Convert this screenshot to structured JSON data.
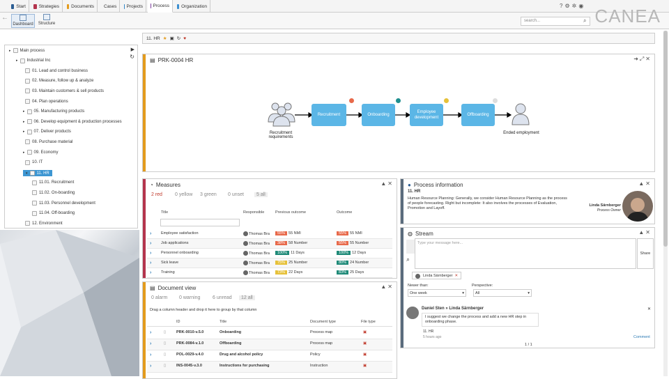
{
  "tabs": [
    "Start",
    "Strategies",
    "Documents",
    "Cases",
    "Projects",
    "Process",
    "Organization"
  ],
  "tab_colors": [
    "#2c5d93",
    "#b4344d",
    "#e39b1d",
    "#4aa34a",
    "#2f86c6",
    "#7d3c9e",
    "#3c8fd0"
  ],
  "subtabs": [
    "Dashboard",
    "Structure"
  ],
  "logo": "CANEA",
  "search_placeholder": "search...",
  "toolbar_label": "11. HR",
  "tree": [
    {
      "label": "Main process",
      "lvl": 0
    },
    {
      "label": "Industrial Inc",
      "lvl": 1
    },
    {
      "label": "01. Lead and control business",
      "lvl": 2
    },
    {
      "label": "02. Measure, follow up & analyze",
      "lvl": 2
    },
    {
      "label": "03. Maintain customers & sell products",
      "lvl": 2
    },
    {
      "label": "04. Plan operations",
      "lvl": 2
    },
    {
      "label": "05. Manufacturing products",
      "lvl": 2
    },
    {
      "label": "06. Develop equipment & production processes",
      "lvl": 2
    },
    {
      "label": "07. Deliver products",
      "lvl": 2
    },
    {
      "label": "08. Purchase material",
      "lvl": 2
    },
    {
      "label": "09. Economy",
      "lvl": 2
    },
    {
      "label": "10. IT",
      "lvl": 2
    },
    {
      "label": "11. HR",
      "lvl": 2,
      "selected": true
    },
    {
      "label": "11.01. Recruitment",
      "lvl": 3
    },
    {
      "label": "11.02. On-boarding",
      "lvl": 3
    },
    {
      "label": "11.03. Personnel development",
      "lvl": 3
    },
    {
      "label": "11.04. Off-boarding",
      "lvl": 3
    },
    {
      "label": "12. Environment",
      "lvl": 2
    }
  ],
  "process": {
    "title": "PRK-0004 HR",
    "start_label": "Recruitment requirements",
    "end_label": "Ended employment",
    "steps": [
      "Recruitment",
      "Onboarding",
      "Employee development",
      "Offboarding"
    ],
    "badge_colors": [
      "#e8694a",
      "#1f8f8f",
      "#e6c13a",
      "#dddddd"
    ]
  },
  "measures": {
    "title": "Measures",
    "filters": [
      "2 red",
      "0 yellow",
      "3 green",
      "0 unset",
      "5 all"
    ],
    "headers": [
      "Title",
      "Responsible",
      "Previous outcome",
      "Outcome"
    ],
    "rows": [
      {
        "title": "Employee satisfaction",
        "resp": "Thomas Bra",
        "prev_pct": "55%",
        "prev_val": "55 NMI",
        "prev_color": "#e8694a",
        "pct": "55%",
        "val": "55 NMI",
        "color": "#e8694a"
      },
      {
        "title": "Job applications",
        "resp": "Thomas Bra",
        "prev_pct": "38%",
        "prev_val": "58 Number",
        "prev_color": "#e8694a",
        "pct": "55%",
        "val": "55 Number",
        "color": "#e8694a"
      },
      {
        "title": "Personnel onboarding",
        "resp": "Thomas Bra",
        "prev_pct": "100%",
        "prev_val": "11 Days",
        "prev_color": "#1f8a78",
        "pct": "100%",
        "val": "12 Days",
        "color": "#1f8a78"
      },
      {
        "title": "Sick leave",
        "resp": "Thomas Bra",
        "prev_pct": "75%",
        "prev_val": "25 Number",
        "prev_color": "#e6c13a",
        "pct": "80%",
        "val": "24 Number",
        "color": "#1f8a78"
      },
      {
        "title": "Training",
        "resp": "Thomas Bra",
        "prev_pct": "73%",
        "prev_val": "22 Days",
        "prev_color": "#e6c13a",
        "pct": "83%",
        "val": "25 Days",
        "color": "#1f8a78"
      }
    ]
  },
  "docs": {
    "title": "Document view",
    "filters": [
      "0 alarm",
      "0 warning",
      "6 unread",
      "12 all"
    ],
    "group_hint": "Drag a column header and drop it here to group by that column",
    "headers": [
      "ID",
      "Title",
      "Document type",
      "File type"
    ],
    "rows": [
      {
        "id": "PRK-0010-v.5.0",
        "title": "Onboarding",
        "type": "Process map"
      },
      {
        "id": "PRK-0084-v.1.0",
        "title": "Offboarding",
        "type": "Process map"
      },
      {
        "id": "POL-0029-v.4.0",
        "title": "Drug and alcohol policy",
        "type": "Policy"
      },
      {
        "id": "INS-0045-v.3.0",
        "title": "Instructions for purchasing",
        "type": "Instruction"
      }
    ]
  },
  "info": {
    "title": "Process information",
    "heading": "11. HR",
    "text": "Human Resource Planning: Generally, we consider Human Resource Planning as the process of people forecasting. Right but incomplete: It also involves the processes of Evaluation, Promotion and Layoff.",
    "owner_name": "Linda Särnberger",
    "owner_role": "Process Owner"
  },
  "stream": {
    "title": "Stream",
    "placeholder": "Type your message here...",
    "share": "Share",
    "tag": "Linda Särnberger",
    "never_label": "Newer than:",
    "never_value": "One week",
    "persp_label": "Perspective:",
    "persp_value": "All",
    "post_author": "Daniel Sten » Linda Särnberger",
    "post_text": "I suggest we change the process and add a new HR step in onboarding phase.",
    "post_ref": "11. HR",
    "post_time": "5 hours ago",
    "comment": "Comment",
    "paging": "1 / 1"
  }
}
